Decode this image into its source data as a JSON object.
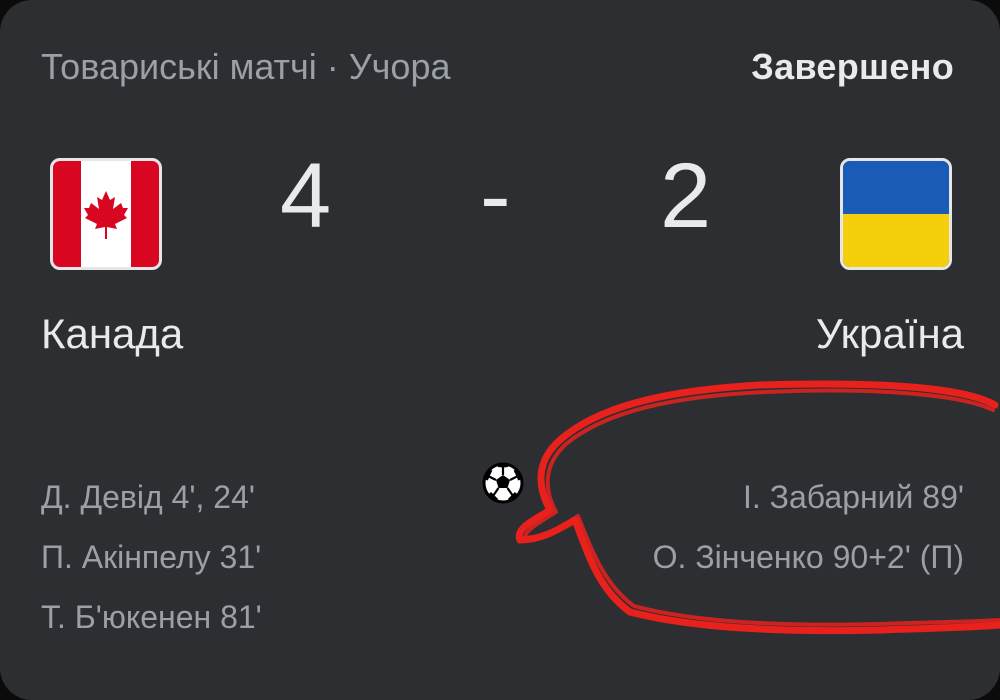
{
  "header": {
    "competition": "Товариські матчі · Учора",
    "status": "Завершено"
  },
  "home": {
    "name": "Канада",
    "score": "4",
    "flag_icon": "canada-flag-icon",
    "scorers": [
      "Д. Девід 4', 24'",
      "П. Акінпелу 31'",
      "Т. Б'юкенен 81'"
    ]
  },
  "away": {
    "name": "Україна",
    "score": "2",
    "flag_icon": "ukraine-flag-icon",
    "scorers": [
      "І. Забарний 89'",
      "О. Зінченко 90+2' (П)"
    ]
  },
  "separator": "-",
  "goal_icon": "soccer-ball-icon",
  "colors": {
    "card_bg": "#2d2e31",
    "primary_text": "#e8eaed",
    "secondary_text": "#9aa0a6",
    "annotation": "#e8211d"
  }
}
